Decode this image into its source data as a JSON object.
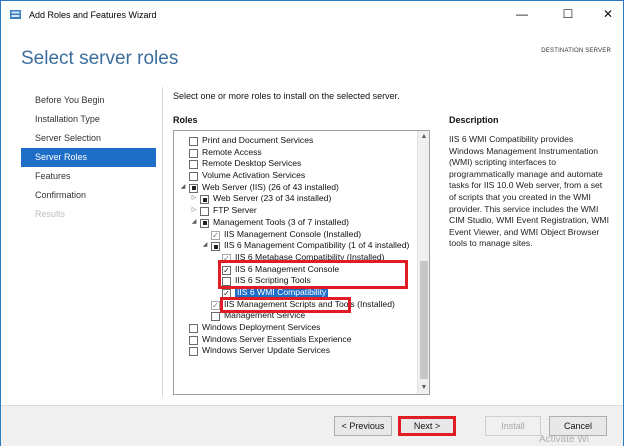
{
  "titlebar": {
    "title": "Add Roles and Features Wizard",
    "minimize_glyph": "—",
    "maximize_glyph": "☐",
    "close_glyph": "✕"
  },
  "header": {
    "title": "Select server roles",
    "destination_label": "DESTINATION SERVER"
  },
  "nav": {
    "items": [
      {
        "label": "Before You Begin",
        "state": "normal"
      },
      {
        "label": "Installation Type",
        "state": "normal"
      },
      {
        "label": "Server Selection",
        "state": "normal"
      },
      {
        "label": "Server Roles",
        "state": "active"
      },
      {
        "label": "Features",
        "state": "normal"
      },
      {
        "label": "Confirmation",
        "state": "normal"
      },
      {
        "label": "Results",
        "state": "disabled"
      }
    ]
  },
  "main": {
    "instruction": "Select one or more roles to install on the selected server.",
    "roles_heading": "Roles",
    "description_heading": "Description",
    "description_text": "IIS 6 WMI Compatibility provides Windows Management Instrumentation (WMI) scripting interfaces to programmatically manage and automate tasks for IIS 10.0 Web server, from a set of scripts that you created in the WMI provider. This service includes the WMI CIM Studio, WMI Event Registration, WMI Event Viewer, and WMI Object Browser tools to manage sites."
  },
  "roles": [
    {
      "label": "Print and Document Services",
      "check": "none",
      "expander": "",
      "indent": 0
    },
    {
      "label": "Remote Access",
      "check": "none",
      "expander": "",
      "indent": 0
    },
    {
      "label": "Remote Desktop Services",
      "check": "none",
      "expander": "",
      "indent": 0
    },
    {
      "label": "Volume Activation Services",
      "check": "none",
      "expander": "",
      "indent": 0
    },
    {
      "label": "Web Server (IIS) (26 of 43 installed)",
      "check": "partial",
      "expander": "◢",
      "indent": 0
    },
    {
      "label": "Web Server (23 of 34 installed)",
      "check": "partial",
      "expander": "▷",
      "indent": 1
    },
    {
      "label": "FTP Server",
      "check": "none",
      "expander": "▷",
      "indent": 1
    },
    {
      "label": "Management Tools (3 of 7 installed)",
      "check": "partial",
      "expander": "◢",
      "indent": 1
    },
    {
      "label": "IIS Management Console (Installed)",
      "check": "checked-gray",
      "expander": "",
      "indent": 2
    },
    {
      "label": "IIS 6 Management Compatibility (1 of 4 installed)",
      "check": "partial",
      "expander": "◢",
      "indent": 2
    },
    {
      "label": "IIS 6 Metabase Compatibility (Installed)",
      "check": "checked-gray",
      "expander": "",
      "indent": 3
    },
    {
      "label": "IIS 6 Management Console",
      "check": "checked",
      "expander": "",
      "indent": 3
    },
    {
      "label": "IIS 6 Scripting Tools",
      "check": "none",
      "expander": "",
      "indent": 3
    },
    {
      "label": "IIS 6 WMI Compatibility",
      "check": "checked",
      "expander": "",
      "indent": 3,
      "selected": true
    },
    {
      "label": "IIS Management Scripts and Tools (Installed)",
      "check": "checked-gray",
      "expander": "",
      "indent": 2
    },
    {
      "label": "Management Service",
      "check": "none",
      "expander": "",
      "indent": 2
    },
    {
      "label": "Windows Deployment Services",
      "check": "none",
      "expander": "",
      "indent": 0
    },
    {
      "label": "Windows Server Essentials Experience",
      "check": "none",
      "expander": "",
      "indent": 0
    },
    {
      "label": "Windows Server Update Services",
      "check": "none",
      "expander": "",
      "indent": 0
    }
  ],
  "scrollbar": {
    "up_glyph": "▲",
    "down_glyph": "▼"
  },
  "footer": {
    "previous_label": "< Previous",
    "next_label": "Next >",
    "install_label": "Install",
    "cancel_label": "Cancel",
    "watermark": "Activate Wi"
  },
  "colors": {
    "accent": "#1e6ec7",
    "title_blue": "#3b6e9e",
    "highlight_red": "#e01c24"
  }
}
